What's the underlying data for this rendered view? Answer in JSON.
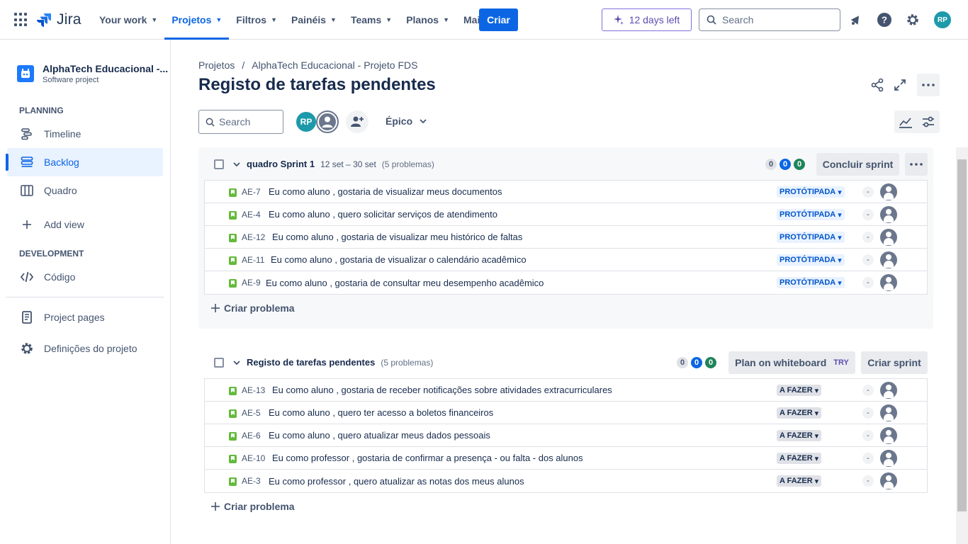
{
  "nav": {
    "product": "Jira",
    "items": [
      {
        "label": "Your work",
        "active": false
      },
      {
        "label": "Projetos",
        "active": true
      },
      {
        "label": "Filtros",
        "active": false
      },
      {
        "label": "Painéis",
        "active": false
      },
      {
        "label": "Teams",
        "active": false
      },
      {
        "label": "Planos",
        "active": false
      },
      {
        "label": "Mais",
        "active": false
      }
    ],
    "create_label": "Criar",
    "trial_label": "12 days left",
    "search_placeholder": "Search",
    "user_initials": "RP"
  },
  "sidebar": {
    "project_name": "AlphaTech Educacional -...",
    "project_type": "Software project",
    "planning_title": "PLANNING",
    "development_title": "DEVELOPMENT",
    "items": [
      {
        "label": "Timeline",
        "icon": "timeline-icon"
      },
      {
        "label": "Backlog",
        "icon": "backlog-icon",
        "active": true
      },
      {
        "label": "Quadro",
        "icon": "board-icon"
      },
      {
        "label": "Add view",
        "icon": "plus-icon"
      },
      {
        "label": "Código",
        "icon": "code-icon"
      },
      {
        "label": "Project pages",
        "icon": "page-icon"
      },
      {
        "label": "Definições do projeto",
        "icon": "gear-icon"
      }
    ]
  },
  "main": {
    "breadcrumb": [
      "Projetos",
      "/",
      "AlphaTech Educacional - Projeto FDS"
    ],
    "title": "Registo de tarefas pendentes",
    "search_placeholder": "Search",
    "avatar_initials": "RP",
    "epic_filter": "Épico"
  },
  "sprint": {
    "name": "quadro Sprint 1",
    "dates": "12 set – 30 set",
    "count": "(5 problemas)",
    "counts": [
      "0",
      "0",
      "0"
    ],
    "complete_label": "Concluir sprint",
    "issues": [
      {
        "key": "AE-7",
        "summary": "Eu como aluno , gostaria de visualizar meus documentos",
        "status": "PROTÓTIPADA"
      },
      {
        "key": "AE-4",
        "summary": "Eu como aluno , quero solicitar serviços de atendimento",
        "status": "PROTÓTIPADA"
      },
      {
        "key": "AE-12",
        "summary": "Eu como aluno , gostaria de visualizar meu histórico de faltas",
        "status": "PROTÓTIPADA"
      },
      {
        "key": "AE-11",
        "summary": "Eu como aluno , gostaria de visualizar o calendário acadêmico",
        "status": "PROTÓTIPADA"
      },
      {
        "key": "AE-9",
        "summary": "Eu como aluno , gostaria de consultar meu desempenho acadêmico",
        "status": "PROTÓTIPADA"
      }
    ],
    "create_issue_label": "Criar problema"
  },
  "backlog": {
    "name": "Registo de tarefas pendentes",
    "count": "(5 problemas)",
    "counts": [
      "0",
      "0",
      "0"
    ],
    "whiteboard_label": "Plan on whiteboard",
    "try_label": "TRY",
    "create_sprint_label": "Criar sprint",
    "issues": [
      {
        "key": "AE-13",
        "summary": "Eu como aluno , gostaria de receber notificações sobre atividades extracurriculares",
        "status": "A FAZER"
      },
      {
        "key": "AE-5",
        "summary": "Eu como aluno , quero ter acesso a boletos financeiros",
        "status": "A FAZER"
      },
      {
        "key": "AE-6",
        "summary": "Eu como aluno , quero atualizar meus dados pessoais",
        "status": "A FAZER"
      },
      {
        "key": "AE-10",
        "summary": "Eu como professor , gostaria de confirmar a presença - ou falta - dos alunos",
        "status": "A FAZER"
      },
      {
        "key": "AE-3",
        "summary": "Eu como professor , quero atualizar as notas dos meus alunos",
        "status": "A FAZER"
      }
    ],
    "create_issue_label": "Criar problema"
  },
  "issue_dash": "-"
}
